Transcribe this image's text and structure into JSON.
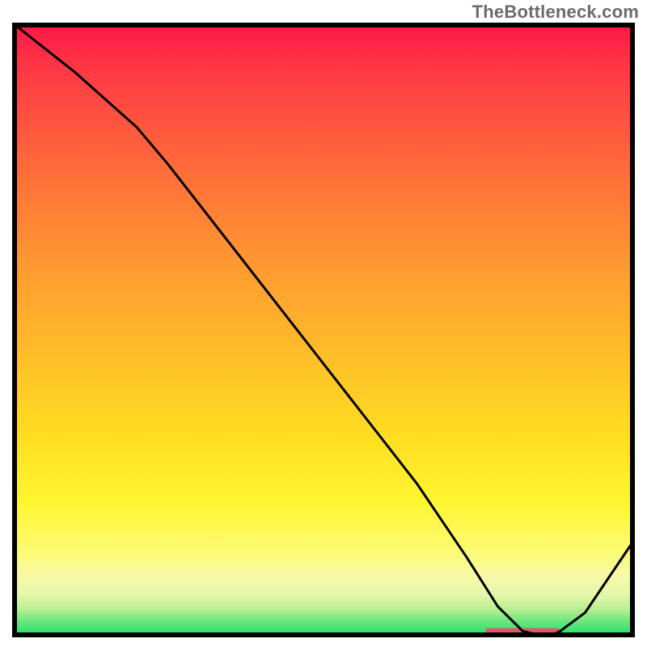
{
  "watermark": "TheBottleneck.com",
  "chart_data": {
    "type": "line",
    "title": "",
    "xlabel": "",
    "ylabel": "",
    "xlim": [
      0,
      100
    ],
    "ylim": [
      0,
      100
    ],
    "grid": false,
    "series": [
      {
        "name": "curve",
        "x": [
          0,
          10,
          20,
          25,
          35,
          45,
          55,
          65,
          73,
          78,
          82,
          86,
          88,
          92,
          100
        ],
        "y": [
          100,
          92,
          83,
          77,
          64,
          51,
          38,
          25,
          13,
          5,
          1,
          0,
          1,
          4,
          16
        ],
        "color": "#000000",
        "stroke_width": 2
      }
    ],
    "marker_band": {
      "color": "#e2556b",
      "x_start": 76,
      "x_end": 88,
      "y": 0.6,
      "height_pct": 1.0
    },
    "background_gradient_stops": [
      {
        "pos": 0,
        "color": "#ff1549"
      },
      {
        "pos": 0.06,
        "color": "#ff3246"
      },
      {
        "pos": 0.18,
        "color": "#ff5a3e"
      },
      {
        "pos": 0.3,
        "color": "#ff7e36"
      },
      {
        "pos": 0.42,
        "color": "#ffa030"
      },
      {
        "pos": 0.55,
        "color": "#ffc028"
      },
      {
        "pos": 0.68,
        "color": "#ffdf22"
      },
      {
        "pos": 0.78,
        "color": "#fff630"
      },
      {
        "pos": 0.86,
        "color": "#fdfb73"
      },
      {
        "pos": 0.9,
        "color": "#f7f9a8"
      },
      {
        "pos": 0.93,
        "color": "#e6f6aa"
      },
      {
        "pos": 0.955,
        "color": "#b7ef93"
      },
      {
        "pos": 0.975,
        "color": "#67e67c"
      },
      {
        "pos": 1.0,
        "color": "#17df6a"
      }
    ]
  }
}
